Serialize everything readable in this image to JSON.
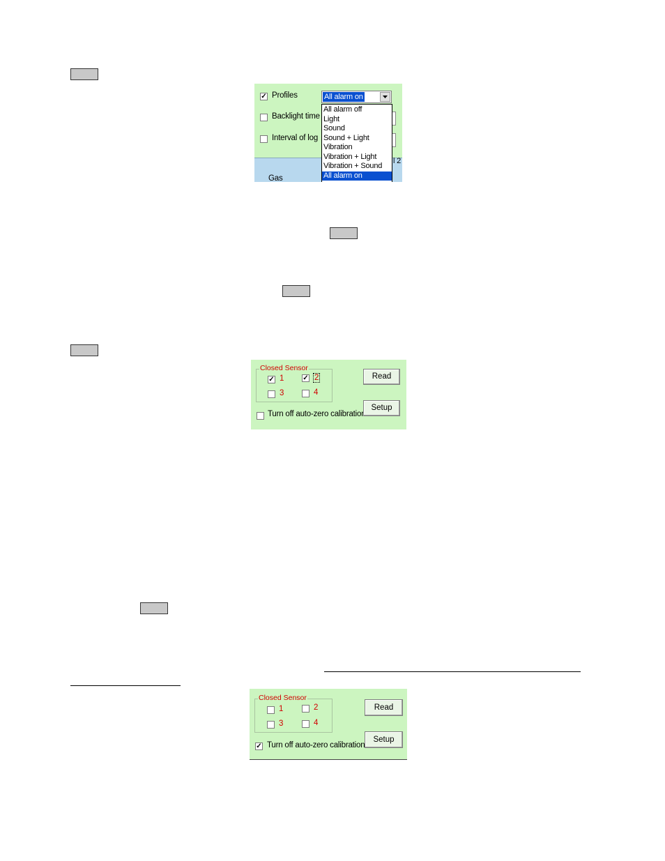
{
  "panel1": {
    "profiles_label": "Profiles",
    "backlight_label": "Backlight time",
    "interval_label": "Interval of log",
    "gas_label": "Gas",
    "profile_select_value": "All alarm on",
    "fragment_right": "l 2",
    "dropdown_options": [
      "All alarm off",
      "Light",
      "Sound",
      "Sound + Light",
      "Vibration",
      "Vibration + Light",
      "Vibration + Sound",
      "All alarm on"
    ],
    "selected_option": "All alarm on"
  },
  "panel2": {
    "group_title": "Closed Sensor",
    "sensor_1": "1",
    "sensor_2": "2",
    "sensor_3": "3",
    "sensor_4": "4",
    "auto_zero_label": "Turn off auto-zero calibration",
    "read_label": "Read",
    "setup_label": "Setup"
  },
  "panel3": {
    "group_title": "Closed Sensor",
    "sensor_1": "1",
    "sensor_2": "2",
    "sensor_3": "3",
    "sensor_4": "4",
    "auto_zero_label": "Turn off auto-zero calibration",
    "read_label": "Read",
    "setup_label": "Setup"
  },
  "colors": {
    "panel_bg": "#ccf5c0",
    "selection": "#0a50d0",
    "sensor_red": "#d00000"
  }
}
